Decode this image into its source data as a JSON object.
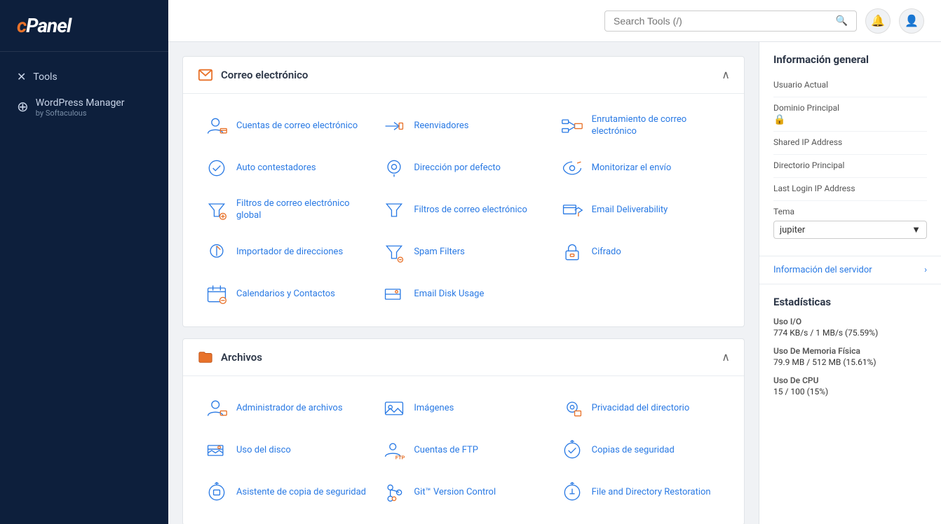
{
  "sidebar": {
    "logo": "cPanel",
    "items": [
      {
        "id": "tools",
        "label": "Tools",
        "icon": "✕"
      },
      {
        "id": "wordpress-manager",
        "label": "WordPress Manager",
        "sub": "by Softaculous",
        "icon": "W"
      }
    ]
  },
  "topbar": {
    "search_placeholder": "Search Tools (/)",
    "search_label": "Search Tools (/)"
  },
  "sections": [
    {
      "id": "correo",
      "title": "Correo electrónico",
      "icon_type": "email",
      "tools": [
        {
          "id": "cuentas-correo",
          "label": "Cuentas de correo electrónico",
          "icon": "user-email"
        },
        {
          "id": "reenviadores",
          "label": "Reenviadores",
          "icon": "forwarders"
        },
        {
          "id": "enrutamiento-correo",
          "label": "Enrutamiento de correo electrónico",
          "icon": "routing"
        },
        {
          "id": "auto-contestadores",
          "label": "Auto contestadores",
          "icon": "autoresponder"
        },
        {
          "id": "direccion-defecto",
          "label": "Dirección por defecto",
          "icon": "default-address"
        },
        {
          "id": "monitorizar-envio",
          "label": "Monitorizar el envío",
          "icon": "monitor-delivery"
        },
        {
          "id": "filtros-globales",
          "label": "Filtros de correo electrónico global",
          "icon": "global-filters"
        },
        {
          "id": "filtros-correo",
          "label": "Filtros de correo electrónico",
          "icon": "filters"
        },
        {
          "id": "email-deliverability",
          "label": "Email Deliverability",
          "icon": "deliverability"
        },
        {
          "id": "importador",
          "label": "Importador de direcciones",
          "icon": "importer"
        },
        {
          "id": "spam-filters",
          "label": "Spam Filters",
          "icon": "spam"
        },
        {
          "id": "cifrado",
          "label": "Cifrado",
          "icon": "encryption"
        },
        {
          "id": "calendarios",
          "label": "Calendarios y Contactos",
          "icon": "calendar"
        },
        {
          "id": "email-disk",
          "label": "Email Disk Usage",
          "icon": "disk"
        }
      ]
    },
    {
      "id": "archivos",
      "title": "Archivos",
      "icon_type": "folder",
      "tools": [
        {
          "id": "admin-archivos",
          "label": "Administrador de archivos",
          "icon": "file-manager"
        },
        {
          "id": "imagenes",
          "label": "Imágenes",
          "icon": "images"
        },
        {
          "id": "privacidad-dir",
          "label": "Privacidad del directorio",
          "icon": "dir-privacy"
        },
        {
          "id": "uso-disco",
          "label": "Uso del disco",
          "icon": "disk-usage"
        },
        {
          "id": "cuentas-ftp",
          "label": "Cuentas de FTP",
          "icon": "ftp"
        },
        {
          "id": "copias-seguridad",
          "label": "Copias de seguridad",
          "icon": "backup"
        },
        {
          "id": "asistente-copia",
          "label": "Asistente de copia de seguridad",
          "icon": "backup-wizard"
        },
        {
          "id": "git-version",
          "label": "Git™ Version Control",
          "icon": "git"
        },
        {
          "id": "file-restoration",
          "label": "File and Directory Restoration",
          "icon": "file-restore"
        }
      ]
    }
  ],
  "right_panel": {
    "info_title": "Información general",
    "usuario_label": "Usuario Actual",
    "usuario_value": "",
    "dominio_label": "Dominio Principal",
    "shared_ip_label": "Shared IP Address",
    "shared_ip_value": "",
    "directorio_label": "Directorio Principal",
    "directorio_value": "",
    "last_login_label": "Last Login IP Address",
    "last_login_value": "",
    "tema_label": "Tema",
    "tema_value": "jupiter",
    "server_info_label": "Información del servidor",
    "stats_title": "Estadísticas",
    "stats": [
      {
        "id": "uso-io",
        "label": "Uso I/O",
        "value": "774 KB/s / 1 MB/s  (75.59%)"
      },
      {
        "id": "memoria",
        "label": "Uso De Memoria Física",
        "value": "79.9 MB / 512 MB  (15.61%)"
      },
      {
        "id": "cpu",
        "label": "Uso De CPU",
        "value": "15 / 100  (15%)"
      }
    ]
  }
}
